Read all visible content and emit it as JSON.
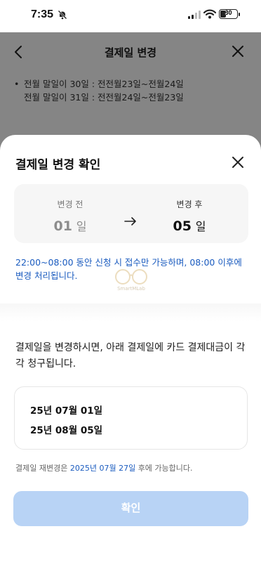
{
  "status_bar": {
    "time": "7:35",
    "battery": "30"
  },
  "background": {
    "title": "결제일 변경",
    "notes": [
      {
        "bullet": "•",
        "text": "전월 말일이 30일 : 전전월23일~전월24일"
      },
      {
        "bullet": "",
        "text": "전월 말일이 31일 : 전전월24일~전월23일"
      }
    ]
  },
  "sheet": {
    "title": "결제일 변경 확인",
    "before": {
      "label": "변경 전",
      "value": "01",
      "unit": "일"
    },
    "after": {
      "label": "변경 후",
      "value": "05",
      "unit": "일"
    },
    "notice": "22:00~08:00 동안 신청 시 접수만 가능하며, 08:00 이후에 변경 처리됩니다.",
    "watermark": "SmartMLab",
    "description": "결제일을 변경하시면, 아래 결제일에 카드 결제대금이 각각 청구됩니다.",
    "dates": [
      "25년 07월 01일",
      "25년 08월 05일"
    ],
    "re_change": {
      "prefix": "결제일 재변경은",
      "date": "2025년 07월 27일",
      "suffix": "후에 가능합니다."
    },
    "confirm_label": "확인"
  },
  "colors": {
    "accent": "#1a5bbf",
    "button_disabled": "#b8d3f5"
  }
}
